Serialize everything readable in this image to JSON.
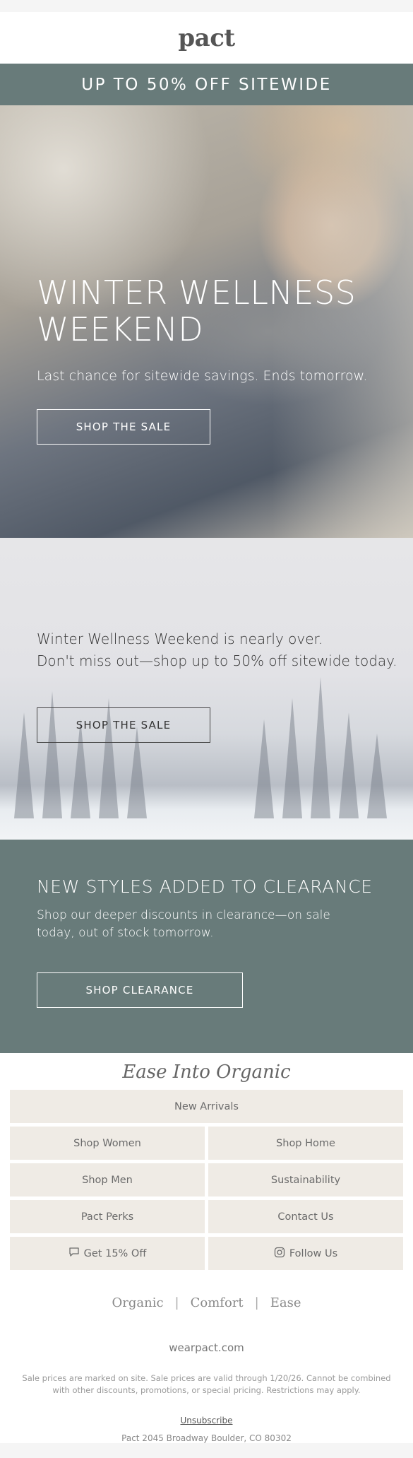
{
  "brand": {
    "logo_text": "pact"
  },
  "promo_bar": {
    "text": "UP TO 50% OFF SITEWIDE"
  },
  "hero": {
    "title_line1": "WINTER WELLNESS",
    "title_line2": "WEEKEND",
    "subtitle": "Last chance for sitewide savings. Ends tomorrow.",
    "cta": "SHOP THE SALE"
  },
  "winter": {
    "line1": "Winter Wellness Weekend is nearly over.",
    "line2": "Don't miss out—shop up to 50% off sitewide today.",
    "cta": "SHOP THE SALE"
  },
  "clearance": {
    "title": "NEW STYLES ADDED TO CLEARANCE",
    "subtitle": "Shop our deeper discounts in clearance—on sale today, out of stock tomorrow.",
    "cta": "SHOP CLEARANCE"
  },
  "nav": {
    "heading": "Ease Into Organic",
    "new_arrivals": "New Arrivals",
    "shop_women": "Shop Women",
    "shop_home": "Shop Home",
    "shop_men": "Shop Men",
    "sustainability": "Sustainability",
    "pact_perks": "Pact Perks",
    "contact_us": "Contact Us",
    "get_off": "Get 15% Off",
    "follow_us": "Follow Us"
  },
  "tagline": {
    "word1": "Organic",
    "word2": "Comfort",
    "word3": "Ease",
    "separator": "|"
  },
  "footer": {
    "site": "wearpact.com",
    "legal": "Sale prices are marked on site. Sale prices are valid through 1/20/26. Cannot be combined with other discounts, promotions, or special pricing. Restrictions may apply.",
    "unsubscribe": "Unsubscribe",
    "address": "Pact 2045 Broadway Boulder, CO 80302"
  },
  "colors": {
    "accent": "#687b7a",
    "nav_cell": "#efebe5"
  },
  "icons": {
    "get_off": "chat-bubble-icon",
    "follow_us": "instagram-icon"
  }
}
